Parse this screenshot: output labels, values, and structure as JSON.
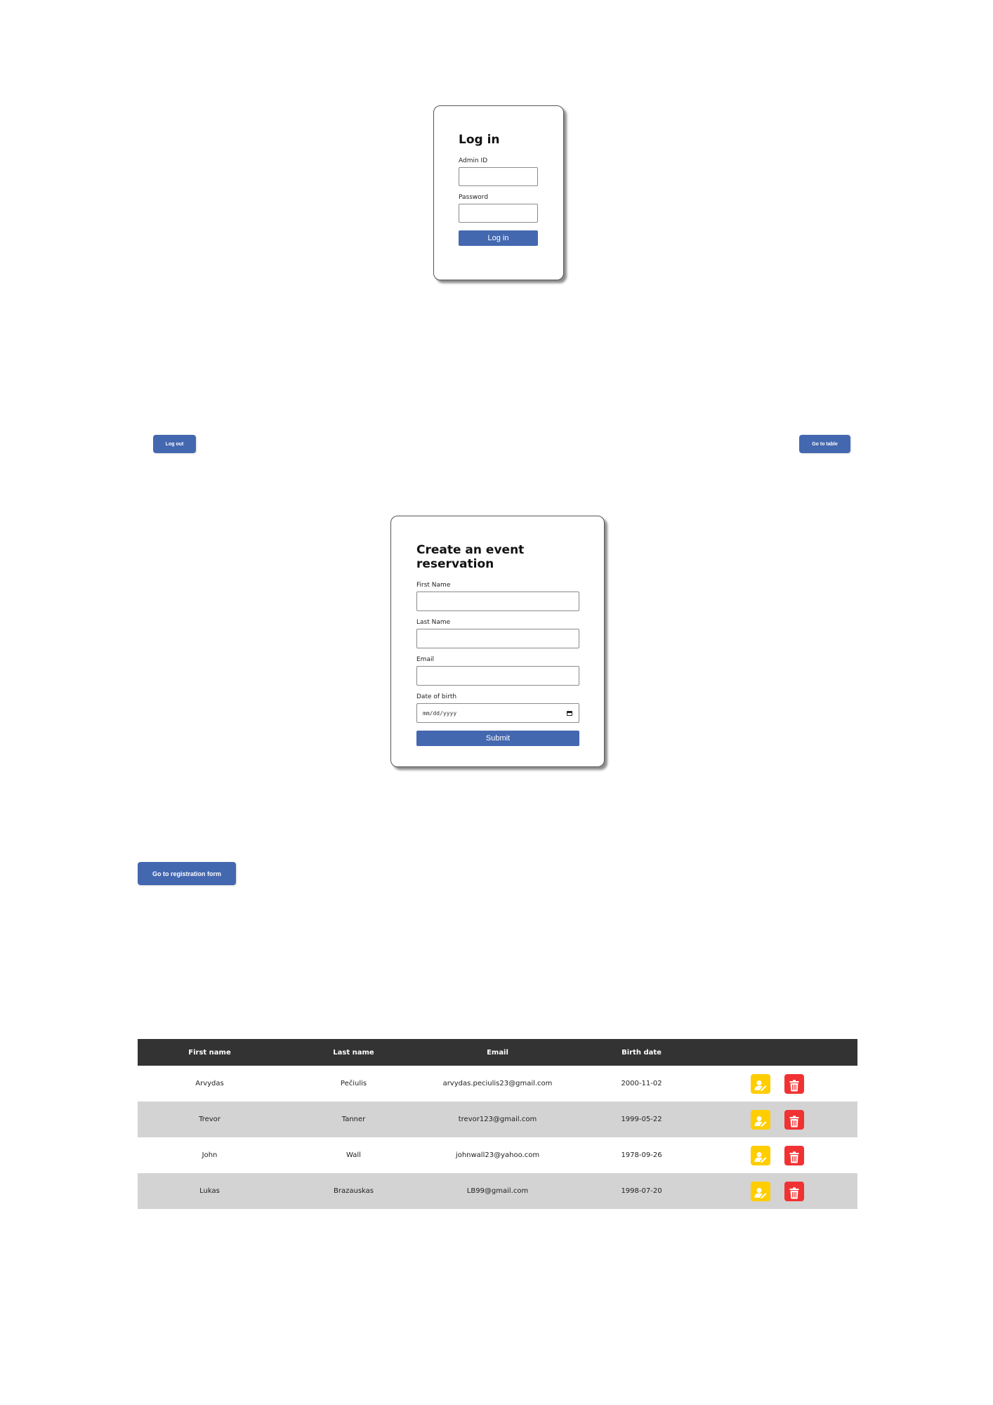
{
  "login": {
    "title": "Log in",
    "admin_id_label": "Admin ID",
    "admin_id_value": "",
    "password_label": "Password",
    "password_value": "",
    "submit_label": "Log in"
  },
  "nav": {
    "logout_label": "Log out",
    "go_table_label": "Go to table",
    "go_registration_label": "Go to registration form"
  },
  "reservation_form": {
    "title": "Create an event reservation",
    "first_name_label": "First Name",
    "first_name_value": "",
    "last_name_label": "Last Name",
    "last_name_value": "",
    "email_label": "Email",
    "email_value": "",
    "dob_label": "Date of birth",
    "dob_placeholder": "mm/dd/yyyy",
    "submit_label": "Submit"
  },
  "table": {
    "headers": [
      "First name",
      "Last name",
      "Email",
      "Birth date",
      ""
    ],
    "rows": [
      {
        "first_name": "Arvydas",
        "last_name": "Pečiulis",
        "email": "arvydas.peciulis23@gmail.com",
        "birth_date": "2000-11-02"
      },
      {
        "first_name": "Trevor",
        "last_name": "Tanner",
        "email": "trevor123@gmail.com",
        "birth_date": "1999-05-22"
      },
      {
        "first_name": "John",
        "last_name": "Wall",
        "email": "johnwall23@yahoo.com",
        "birth_date": "1978-09-26"
      },
      {
        "first_name": "Lukas",
        "last_name": "Brazauskas",
        "email": "LB99@gmail.com",
        "birth_date": "1998-07-20"
      }
    ],
    "row_icons": {
      "edit": "user-edit-icon",
      "delete": "trash-icon"
    }
  },
  "colors": {
    "primary": "#4468b0",
    "table_header": "#333333",
    "row_stripe": "#d3d3d3",
    "edit": "#ffcd00",
    "delete": "#f03232"
  }
}
